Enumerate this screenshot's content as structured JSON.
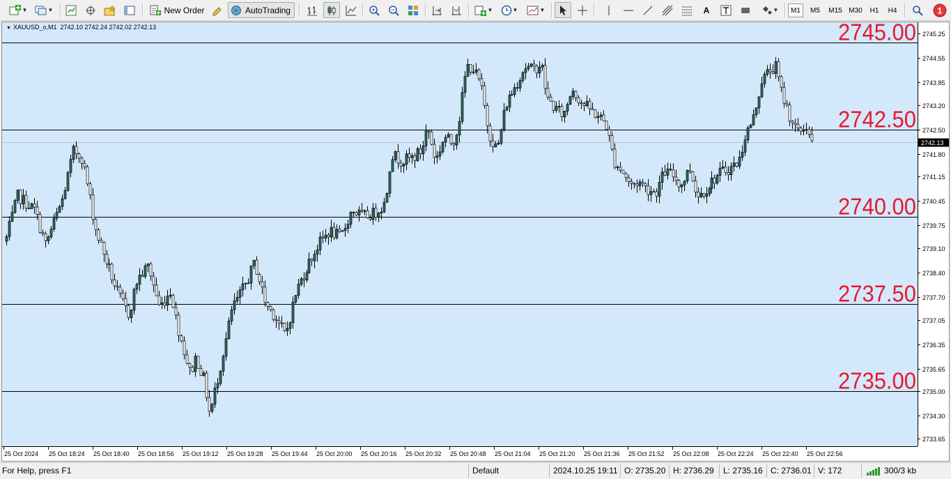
{
  "toolbar": {
    "new_order_label": "New Order",
    "autotrading_label": "AutoTrading",
    "timeframes": [
      "M1",
      "M5",
      "M15",
      "M30",
      "H1",
      "H4"
    ],
    "active_timeframe": "M1",
    "notification_count": "1"
  },
  "chart_header": {
    "symbol": "XAUUSD_o,M1",
    "ohlc": "2742.10 2742.24 2742.02 2742.13"
  },
  "colors": {
    "chart_bg": "#d4e8fc",
    "bull_body": "#2e6f6a",
    "bear_body": "#ffffff",
    "candle_outline": "#000000",
    "level_label": "#e8192c",
    "bid_label_bg": "#000000"
  },
  "chart_data": {
    "type": "candlestick",
    "symbol": "XAUUSD_o",
    "timeframe": "M1",
    "ylim": [
      2733.43,
      2745.57
    ],
    "y_ticks": [
      "2745.25",
      "2744.55",
      "2743.85",
      "2743.20",
      "2742.50",
      "2741.80",
      "2741.15",
      "2740.45",
      "2739.75",
      "2739.10",
      "2738.40",
      "2737.70",
      "2737.05",
      "2736.35",
      "2735.65",
      "2735.00",
      "2734.30",
      "2733.65"
    ],
    "x_ticks": [
      "25 Oct 2024",
      "25 Oct 18:24",
      "25 Oct 18:40",
      "25 Oct 18:56",
      "25 Oct 19:12",
      "25 Oct 19:28",
      "25 Oct 19:44",
      "25 Oct 20:00",
      "25 Oct 20:16",
      "25 Oct 20:32",
      "25 Oct 20:48",
      "25 Oct 21:04",
      "25 Oct 21:20",
      "25 Oct 21:36",
      "25 Oct 21:52",
      "25 Oct 22:08",
      "25 Oct 22:24",
      "25 Oct 22:40",
      "25 Oct 22:56"
    ],
    "horizontal_levels": [
      {
        "value": 2745.0,
        "label": "2745.00"
      },
      {
        "value": 2742.5,
        "label": "2742.50"
      },
      {
        "value": 2740.0,
        "label": "2740.00"
      },
      {
        "value": 2737.5,
        "label": "2737.50"
      },
      {
        "value": 2735.0,
        "label": "2735.00"
      }
    ],
    "current_price": "2742.13",
    "current_price_value": 2742.13,
    "close_path": [
      [
        0,
        2739.4
      ],
      [
        4,
        2740.6
      ],
      [
        10,
        2740.2
      ],
      [
        14,
        2739.2
      ],
      [
        20,
        2740.5
      ],
      [
        24,
        2741.9
      ],
      [
        27,
        2741.7
      ],
      [
        29,
        2740.9
      ],
      [
        32,
        2739.6
      ],
      [
        36,
        2738.7
      ],
      [
        40,
        2737.8
      ],
      [
        44,
        2737.2
      ],
      [
        47,
        2738.2
      ],
      [
        51,
        2738.6
      ],
      [
        55,
        2737.4
      ],
      [
        59,
        2737.9
      ],
      [
        61,
        2737.0
      ],
      [
        64,
        2736.1
      ],
      [
        66,
        2735.5
      ],
      [
        68,
        2736.0
      ],
      [
        71,
        2735.3
      ],
      [
        73,
        2734.3
      ],
      [
        75,
        2735.1
      ],
      [
        78,
        2736.2
      ],
      [
        81,
        2737.4
      ],
      [
        84,
        2737.8
      ],
      [
        87,
        2738.3
      ],
      [
        89,
        2738.7
      ],
      [
        93,
        2737.5
      ],
      [
        96,
        2737.2
      ],
      [
        100,
        2736.6
      ],
      [
        104,
        2737.9
      ],
      [
        108,
        2738.6
      ],
      [
        112,
        2739.2
      ],
      [
        116,
        2739.6
      ],
      [
        120,
        2739.4
      ],
      [
        124,
        2740.2
      ],
      [
        128,
        2740.0
      ],
      [
        132,
        2740.1
      ],
      [
        136,
        2740.4
      ],
      [
        138,
        2741.8
      ],
      [
        142,
        2741.6
      ],
      [
        146,
        2741.7
      ],
      [
        149,
        2741.9
      ],
      [
        151,
        2742.6
      ],
      [
        154,
        2741.6
      ],
      [
        157,
        2742.3
      ],
      [
        160,
        2742.1
      ],
      [
        162,
        2742.6
      ],
      [
        165,
        2744.3
      ],
      [
        167,
        2744.3
      ],
      [
        170,
        2743.8
      ],
      [
        173,
        2742.4
      ],
      [
        176,
        2741.9
      ],
      [
        179,
        2743.2
      ],
      [
        183,
        2743.8
      ],
      [
        186,
        2744.3
      ],
      [
        189,
        2744.2
      ],
      [
        192,
        2744.4
      ],
      [
        194,
        2743.4
      ],
      [
        197,
        2743.1
      ],
      [
        200,
        2742.9
      ],
      [
        203,
        2743.7
      ],
      [
        206,
        2743.3
      ],
      [
        209,
        2743.1
      ],
      [
        212,
        2742.9
      ],
      [
        215,
        2742.7
      ],
      [
        218,
        2741.6
      ],
      [
        221,
        2741.3
      ],
      [
        224,
        2740.9
      ],
      [
        227,
        2741.0
      ],
      [
        230,
        2740.8
      ],
      [
        233,
        2740.7
      ],
      [
        236,
        2741.3
      ],
      [
        239,
        2741.2
      ],
      [
        242,
        2740.9
      ],
      [
        245,
        2741.4
      ],
      [
        248,
        2740.6
      ],
      [
        251,
        2740.8
      ],
      [
        254,
        2741.1
      ],
      [
        257,
        2741.3
      ],
      [
        260,
        2741.4
      ],
      [
        263,
        2741.6
      ],
      [
        265,
        2742.3
      ],
      [
        268,
        2742.8
      ],
      [
        271,
        2743.9
      ],
      [
        274,
        2744.2
      ],
      [
        276,
        2744.3
      ],
      [
        278,
        2743.6
      ],
      [
        281,
        2742.9
      ],
      [
        284,
        2742.4
      ],
      [
        287,
        2742.6
      ],
      [
        289,
        2742.1
      ]
    ]
  },
  "statusbar": {
    "help": "For Help, press F1",
    "profile": "Default",
    "datetime": "2024.10.25 19:11",
    "open": "O: 2735.20",
    "high": "H: 2736.29",
    "low": "L: 2735.16",
    "close": "C: 2736.01",
    "volume": "V: 172",
    "traffic": "300/3 kb"
  }
}
